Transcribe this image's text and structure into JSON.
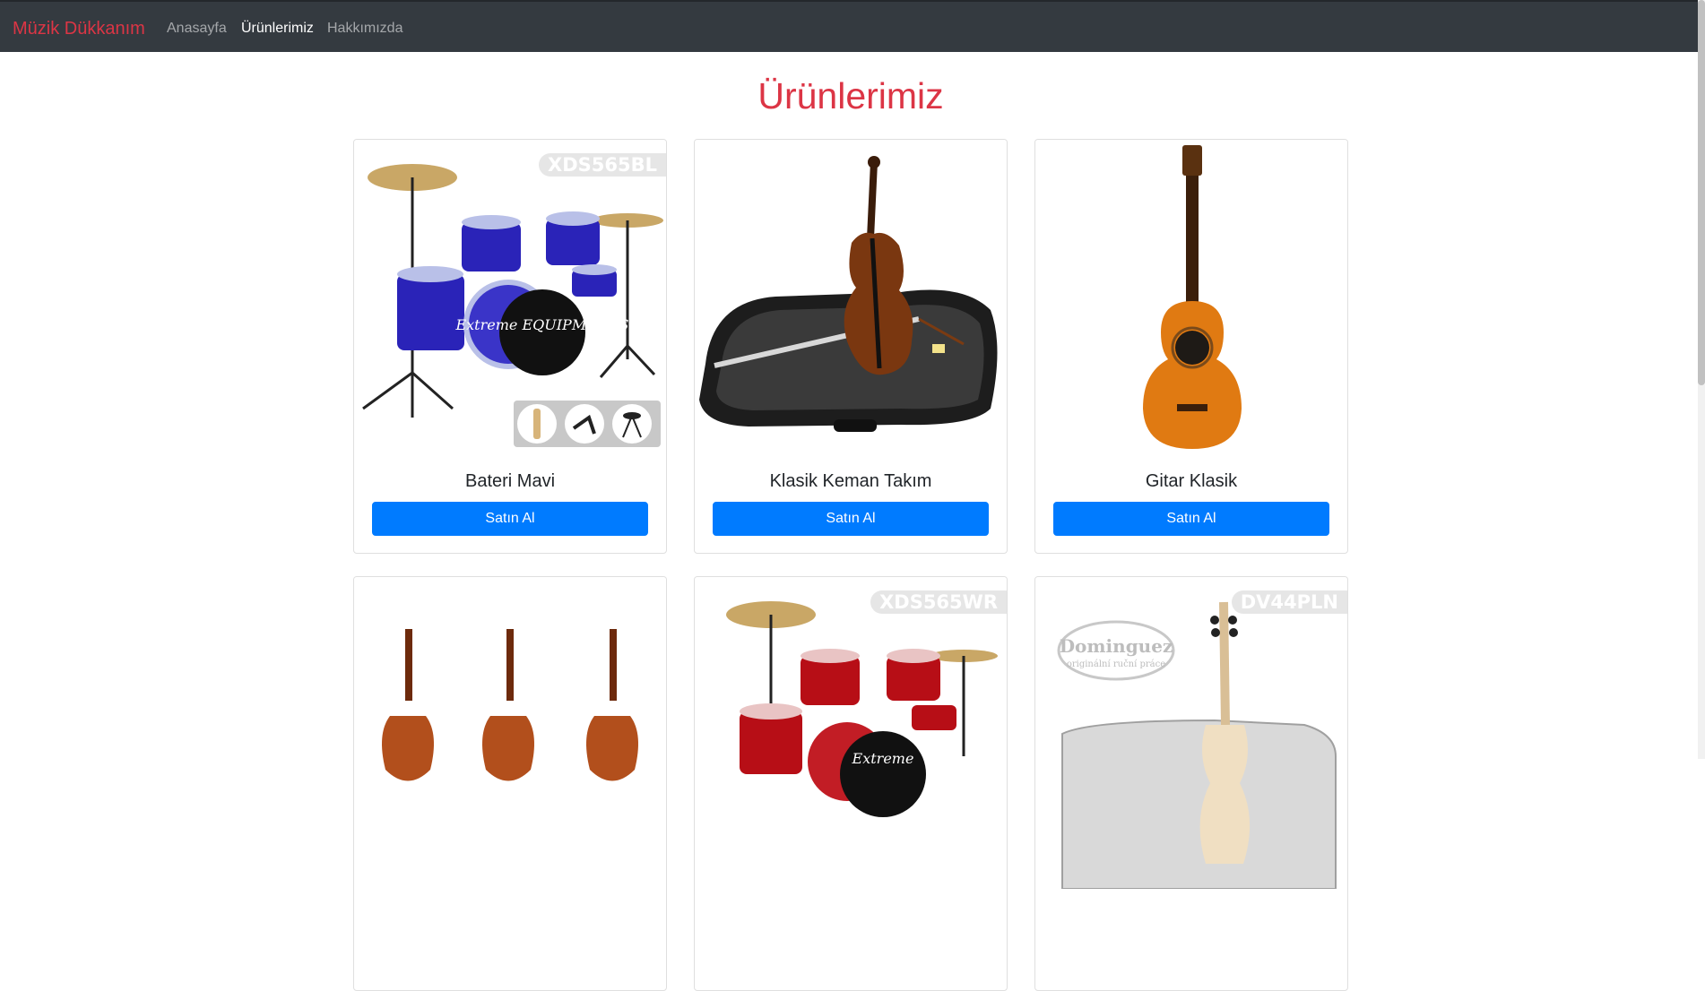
{
  "navbar": {
    "brand": "Müzik Dükkanım",
    "links": [
      {
        "label": "Anasayfa",
        "active": false
      },
      {
        "label": "Ürünlerimiz",
        "active": true
      },
      {
        "label": "Hakkımızda",
        "active": false
      }
    ]
  },
  "page": {
    "title": "Ürünlerimiz"
  },
  "products": [
    {
      "name": "Bateri Mavi",
      "button": "Satın Al",
      "image_code": "XDS565BL",
      "image": "drum-kit-blue",
      "brand_mark": "Extreme EQUIPMENTS"
    },
    {
      "name": "Klasik Keman Takım",
      "button": "Satın Al",
      "image": "violin-in-case"
    },
    {
      "name": "Gitar Klasik",
      "button": "Satın Al",
      "image": "classical-guitar"
    },
    {
      "name": "",
      "button": "",
      "image": "three-violins"
    },
    {
      "name": "",
      "button": "",
      "image_code": "XDS565WR",
      "image": "drum-kit-red",
      "brand_mark": "Extreme"
    },
    {
      "name": "",
      "button": "",
      "image_code": "DV44PLN",
      "image": "plain-violin-case",
      "brand_mark": "Dominguez",
      "brand_sub": "originální ruční práce"
    }
  ],
  "colors": {
    "navbar_bg": "#343a40",
    "brand": "#dc3545",
    "title": "#dc3545",
    "button": "#007bff"
  }
}
